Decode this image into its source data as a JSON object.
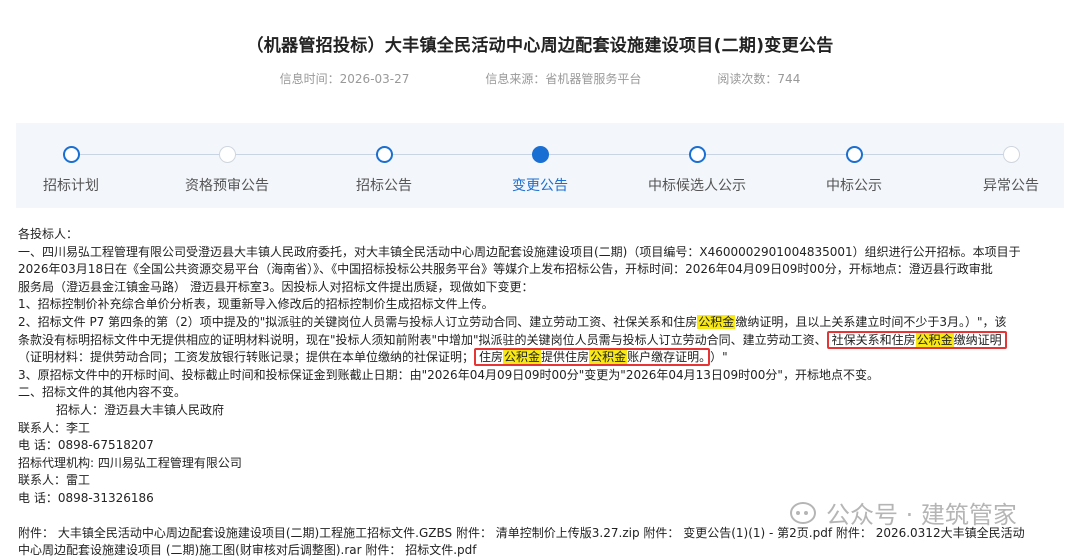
{
  "header": {
    "title": "（机器管招投标）大丰镇全民活动中心周边配套设施建设项目(二期)变更公告",
    "info_time": "信息时间：2026-03-27",
    "info_source": "信息来源：省机器管服务平台",
    "read_count": "阅读次数：744"
  },
  "steps": [
    {
      "label": "招标计划",
      "state": "done"
    },
    {
      "label": "资格预审公告",
      "state": "inactive"
    },
    {
      "label": "招标公告",
      "state": "done"
    },
    {
      "label": "变更公告",
      "state": "active"
    },
    {
      "label": "中标候选人公示",
      "state": "done"
    },
    {
      "label": "中标公示",
      "state": "done"
    },
    {
      "label": "异常公告",
      "state": "inactive"
    }
  ],
  "body": {
    "l1": "各投标人：",
    "l2": "一、四川易弘工程管理有限公司受澄迈县大丰镇人民政府委托，对大丰镇全民活动中心周边配套设施建设项目(二期)（项目编号：X4600002901004835001）组织进行公开招标。本项目于",
    "l3": "2026年03月18日在《全国公共资源交易平台（海南省）》、《中国招标投标公共服务平台》等媒介上发布招标公告，开标时间：2026年04月09日09时00分，开标地点：澄迈县行政审批",
    "l4": "服务局（澄迈县金江镇金马路） 澄迈县开标室3。因投标人对招标文件提出质疑，现做如下变更：",
    "l5": "1、招标控制价补充综合单价分析表，现重新导入修改后的招标控制价生成招标文件上传。",
    "l6a": "2、招标文件 P7 第四条的第（2）项中提及的\"拟派驻的关键岗位人员需与投标人订立劳动合同、建立劳动工资、社保关系和住房",
    "l6hl": "公积金",
    "l6b": "缴纳证明，且以上关系建立时间不少于3月。）\"，该",
    "l7a": "条款没有标明招标文件中无提供相应的证明材料说明，现在\"投标人须知前附表\"中增加\"拟派驻的关键岗位人员需与投标人订立劳动合同、建立劳动工资、",
    "l7box_a": "社保关系和住房",
    "l7box_hl": "公积金",
    "l7box_b": "缴纳证明",
    "l8a": "（证明材料：提供劳动合同；工资发放银行转账记录；提供在本单位缴纳的社保证明；",
    "l8box_a": "住房",
    "l8box_hl1": "公积金",
    "l8box_b": "提供住房",
    "l8box_hl2": "公积金",
    "l8box_c": "账户缴存证明。",
    "l8d": "）\"",
    "l9": "3、原招标文件中的开标时间、投标截止时间和投标保证金到账截止日期：由\"2026年04月09日09时00分\"变更为\"2026年04月13日09时00分\"，开标地点不变。",
    "l10": "二、招标文件的其他内容不变。",
    "l11": "招标人：澄迈县大丰镇人民政府",
    "l12": "联系人：李工",
    "l13": "电 话：0898-67518207",
    "l14": "招标代理机构: 四川易弘工程管理有限公司",
    "l15": "联系人：雷工",
    "l16": "电 话：0898-31326186",
    "att1": "附件： 大丰镇全民活动中心周边配套设施建设项目(二期)工程施工招标文件.GZBS 附件： 清单控制价上传版3.27.zip 附件： 变更公告(1)(1) - 第2页.pdf 附件： 2026.0312大丰镇全民活动",
    "att2": "中心周边配套设施建设项目 (二期)施工图(财审核对后调整图).rar 附件： 招标文件.pdf"
  },
  "watermark": "公众号 · 建筑管家"
}
